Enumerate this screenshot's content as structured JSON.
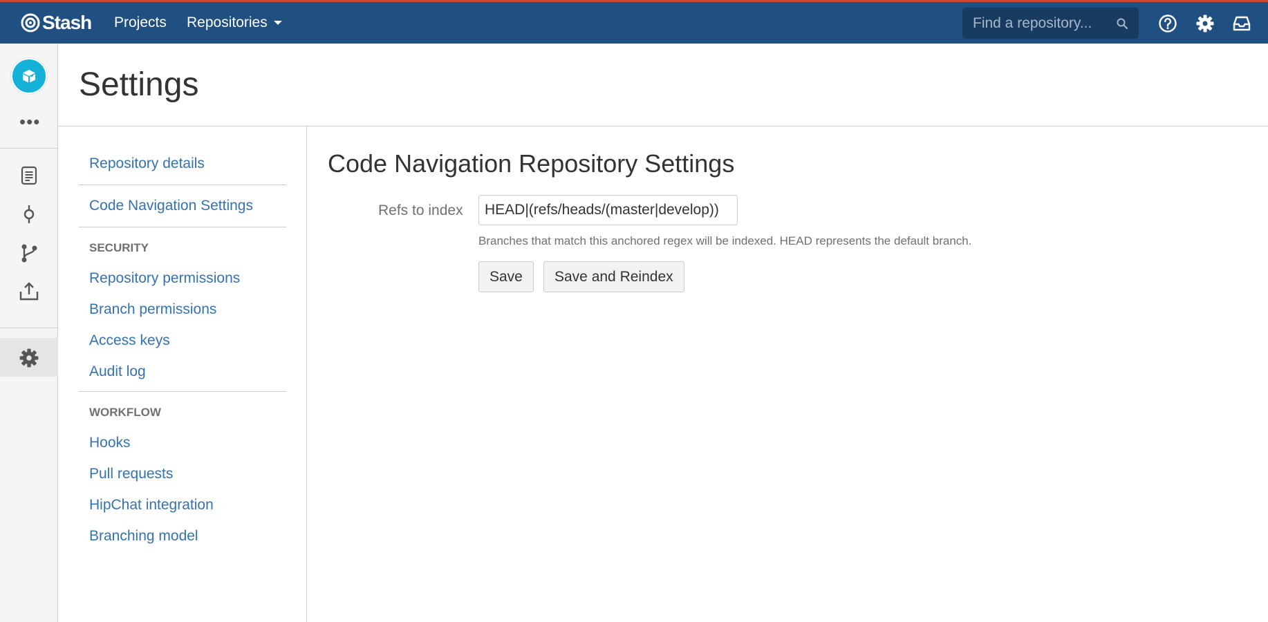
{
  "header": {
    "logo_text": "Stash",
    "nav": {
      "projects": "Projects",
      "repositories": "Repositories"
    },
    "search_placeholder": "Find a repository...",
    "colors": {
      "bar": "#205081",
      "accent_line": "#d04437"
    }
  },
  "sidebar": {
    "avatar_color": "#14b1d9",
    "more": "•••",
    "icons": [
      "source-icon",
      "commits-icon",
      "branches-icon",
      "fork-icon",
      "settings-icon"
    ]
  },
  "page": {
    "title": "Settings"
  },
  "settings_nav": {
    "repository_details": "Repository details",
    "code_navigation": "Code Navigation Settings",
    "security_heading": "SECURITY",
    "security_items": [
      "Repository permissions",
      "Branch permissions",
      "Access keys",
      "Audit log"
    ],
    "workflow_heading": "WORKFLOW",
    "workflow_items": [
      "Hooks",
      "Pull requests",
      "HipChat integration",
      "Branching model"
    ]
  },
  "main": {
    "title": "Code Navigation Repository Settings",
    "refs_label": "Refs to index",
    "refs_value": "HEAD|(refs/heads/(master|develop))",
    "help": "Branches that match this anchored regex will be indexed. HEAD represents the default branch.",
    "save_label": "Save",
    "reindex_label": "Save and Reindex"
  }
}
